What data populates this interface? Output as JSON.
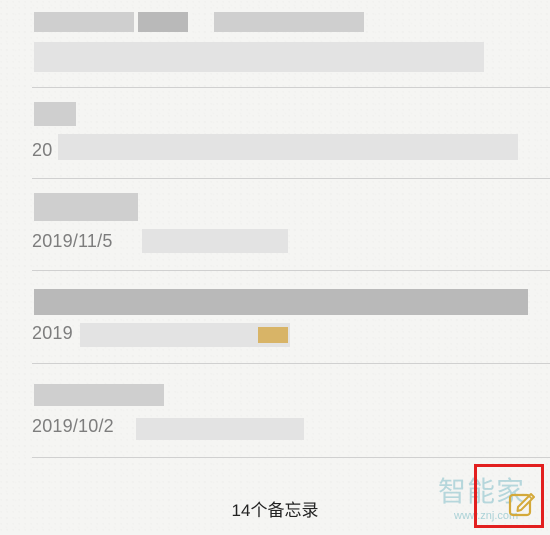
{
  "notes": [
    {
      "date": ""
    },
    {
      "date": "20"
    },
    {
      "date": "2019/11/5"
    },
    {
      "date": "2019"
    },
    {
      "date": "2019/10/2"
    }
  ],
  "footer": {
    "count_label": "14个备忘录"
  },
  "watermark": {
    "text": "智能家",
    "url": "www.znj.com"
  },
  "colors": {
    "background": "#f5f5f3",
    "divider": "#d0d0d0",
    "date_text": "#7d7d7d",
    "compose_icon": "#d4a93a",
    "highlight_box": "#e21f1f"
  },
  "icons": {
    "compose": "compose-note-icon"
  }
}
